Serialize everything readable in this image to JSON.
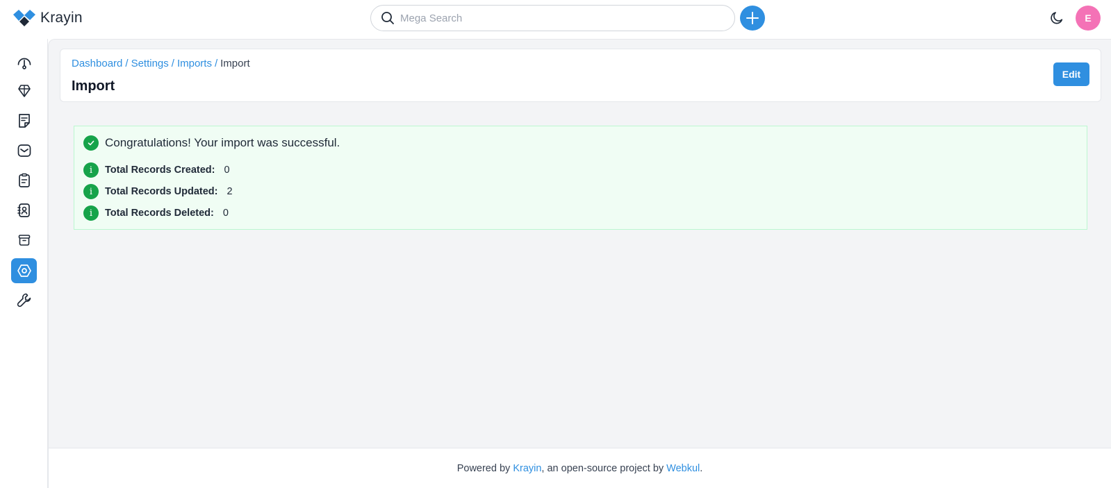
{
  "header": {
    "brand": "Krayin",
    "search_placeholder": "Mega Search",
    "avatar_initial": "E",
    "accent_color": "#2f8fe0"
  },
  "sidebar": {
    "items": [
      {
        "icon": "dashboard-gauge-icon",
        "active": false
      },
      {
        "icon": "leads-icon",
        "active": false
      },
      {
        "icon": "quotes-icon",
        "active": false
      },
      {
        "icon": "mail-icon",
        "active": false
      },
      {
        "icon": "activities-icon",
        "active": false
      },
      {
        "icon": "contacts-icon",
        "active": false
      },
      {
        "icon": "products-icon",
        "active": false
      },
      {
        "icon": "settings-icon",
        "active": true
      },
      {
        "icon": "configuration-wrench-icon",
        "active": false
      }
    ]
  },
  "breadcrumb": {
    "items": [
      "Dashboard",
      "Settings",
      "Imports"
    ],
    "separator": "/",
    "current": "Import"
  },
  "page": {
    "title": "Import",
    "edit_label": "Edit"
  },
  "result": {
    "message": "Congratulations! Your import was successful.",
    "stats": [
      {
        "label": "Total Records Created:",
        "value": "0"
      },
      {
        "label": "Total Records Updated:",
        "value": "2"
      },
      {
        "label": "Total Records Deleted:",
        "value": "0"
      }
    ],
    "status_color": "#16a34a"
  },
  "footer": {
    "prefix": "Powered by",
    "brand_link": "Krayin",
    "middle": ", an open-source project by",
    "company_link": "Webkul",
    "suffix": "."
  }
}
